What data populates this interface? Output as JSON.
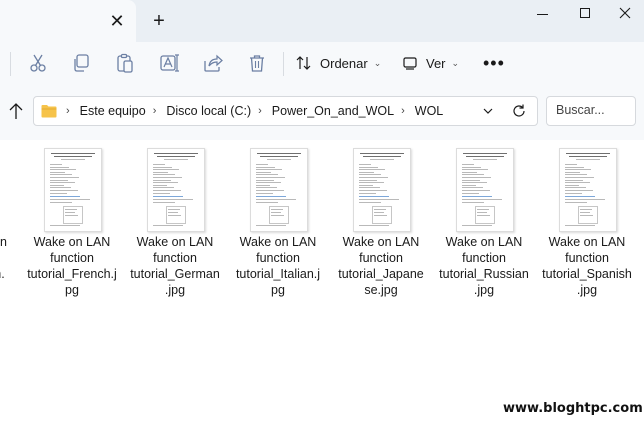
{
  "window": {
    "close_tab_glyph": "✕",
    "new_tab_glyph": "+"
  },
  "toolbar": {
    "icons": [
      "cut-icon",
      "copy-icon",
      "paste-icon",
      "rename-icon",
      "share-icon",
      "delete-icon"
    ],
    "sort_label": "Ordenar",
    "view_label": "Ver",
    "more_label": "•••"
  },
  "address": {
    "crumbs": [
      "Este equipo",
      "Disco local (C:)",
      "Power_On_and_WOL",
      "WOL"
    ],
    "separator": "›"
  },
  "search": {
    "placeholder": "Buscar..."
  },
  "files": {
    "partial": [
      "n",
      "sh."
    ],
    "items": [
      {
        "name": "Wake on LAN function tutorial_French.jpg",
        "lines": [
          "Wake on LAN",
          "function",
          "tutorial_French.j",
          "pg"
        ]
      },
      {
        "name": "Wake on LAN function tutorial_German.jpg",
        "lines": [
          "Wake on LAN",
          "function",
          "tutorial_German",
          ".jpg"
        ]
      },
      {
        "name": "Wake on LAN function tutorial_Italian.jpg",
        "lines": [
          "Wake on LAN",
          "function",
          "tutorial_Italian.j",
          "pg"
        ]
      },
      {
        "name": "Wake on LAN function tutorial_Japanese.jpg",
        "lines": [
          "Wake on LAN",
          "function",
          "tutorial_Japane",
          "se.jpg"
        ]
      },
      {
        "name": "Wake on LAN function tutorial_Russian.jpg",
        "lines": [
          "Wake on LAN",
          "function",
          "tutorial_Russian",
          ".jpg"
        ]
      },
      {
        "name": "Wake on LAN function tutorial_Spanish.jpg",
        "lines": [
          "Wake on LAN",
          "function",
          "tutorial_Spanish",
          ".jpg"
        ]
      }
    ]
  },
  "watermark": "www.bloghtpc.com",
  "colors": {
    "titlebar": "#eaeff4",
    "toolbar": "#f7f9fb",
    "folder": "#f6c34a",
    "icon": "#6b7fa3"
  }
}
